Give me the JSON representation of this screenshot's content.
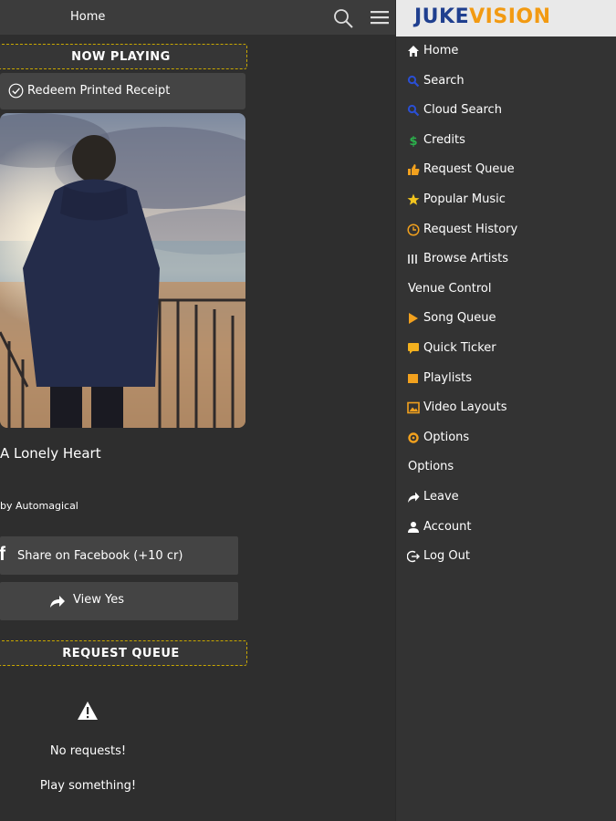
{
  "header": {
    "title": "Home"
  },
  "now_playing": {
    "section_title": "NOW PLAYING",
    "redeem_label": "Redeem Printed Receipt",
    "song_title": "A Lonely Heart",
    "song_by": "by Automagical",
    "facebook_label": "Share on Facebook (+10 cr)",
    "facebook_icon": "f",
    "view_label": "View Yes"
  },
  "request_queue": {
    "section_title": "REQUEST QUEUE",
    "empty_title": "No requests!",
    "empty_subtitle": "Play something!"
  },
  "logo": {
    "part1": "JUKE",
    "part2": "VISION"
  },
  "menu": {
    "items": [
      {
        "label": "Home",
        "icon": "home-icon",
        "color": "#ffffff"
      },
      {
        "label": "Search",
        "icon": "search-icon",
        "color": "#2a4fd4"
      },
      {
        "label": "Cloud Search",
        "icon": "cloud-search-icon",
        "color": "#2a4fd4"
      },
      {
        "label": "Credits",
        "icon": "dollar-icon",
        "color": "#2bb24c"
      },
      {
        "label": "Request Queue",
        "icon": "thumbs-up-icon",
        "color": "#f2a11e"
      },
      {
        "label": "Popular Music",
        "icon": "star-icon",
        "color": "#f2c41e"
      },
      {
        "label": "Request History",
        "icon": "clock-icon",
        "color": "#f2a11e"
      },
      {
        "label": "Browse Artists",
        "icon": "bars-icon",
        "color": "#cccccc"
      },
      {
        "label": "Venue Control",
        "icon": "",
        "color": ""
      },
      {
        "label": "Song Queue",
        "icon": "play-icon",
        "color": "#f2a11e"
      },
      {
        "label": "Quick Ticker",
        "icon": "chat-icon",
        "color": "#f2b01e"
      },
      {
        "label": "Playlists",
        "icon": "playlist-icon",
        "color": "#f2a11e"
      },
      {
        "label": "Video Layouts",
        "icon": "image-icon",
        "color": "#f2a11e"
      },
      {
        "label": "Options",
        "icon": "gear-icon",
        "color": "#f2a11e"
      },
      {
        "label": "Options",
        "icon": "",
        "color": ""
      },
      {
        "label": "Leave",
        "icon": "share-icon",
        "color": "#ffffff"
      },
      {
        "label": "Account",
        "icon": "user-icon",
        "color": "#ffffff"
      },
      {
        "label": "Log Out",
        "icon": "logout-icon",
        "color": "#ffffff"
      }
    ]
  }
}
